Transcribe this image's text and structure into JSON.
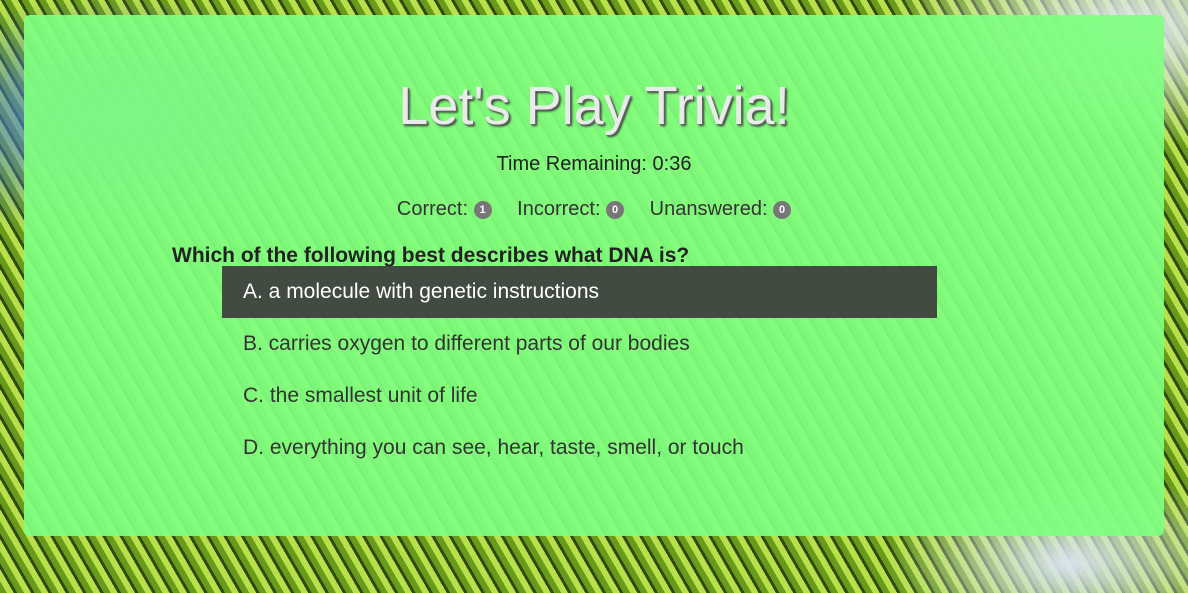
{
  "title": "Let's Play Trivia!",
  "timer": {
    "label": "Time Remaining:",
    "value": "0:36"
  },
  "scores": [
    {
      "label": "Correct:",
      "count": "1"
    },
    {
      "label": "Incorrect:",
      "count": "0"
    },
    {
      "label": "Unanswered:",
      "count": "0"
    }
  ],
  "question": "Which of the following best describes what DNA is?",
  "answers": [
    {
      "text": "A. a molecule with genetic instructions",
      "selected": true
    },
    {
      "text": "B. carries oxygen to different parts of our bodies"
    },
    {
      "text": "C. the smallest unit of life"
    },
    {
      "text": "D. everything you can see, hear, taste, smell, or touch"
    }
  ],
  "colors": {
    "panel": "#80ff80",
    "selected": "#3c3c3c",
    "badge": "#777777"
  }
}
